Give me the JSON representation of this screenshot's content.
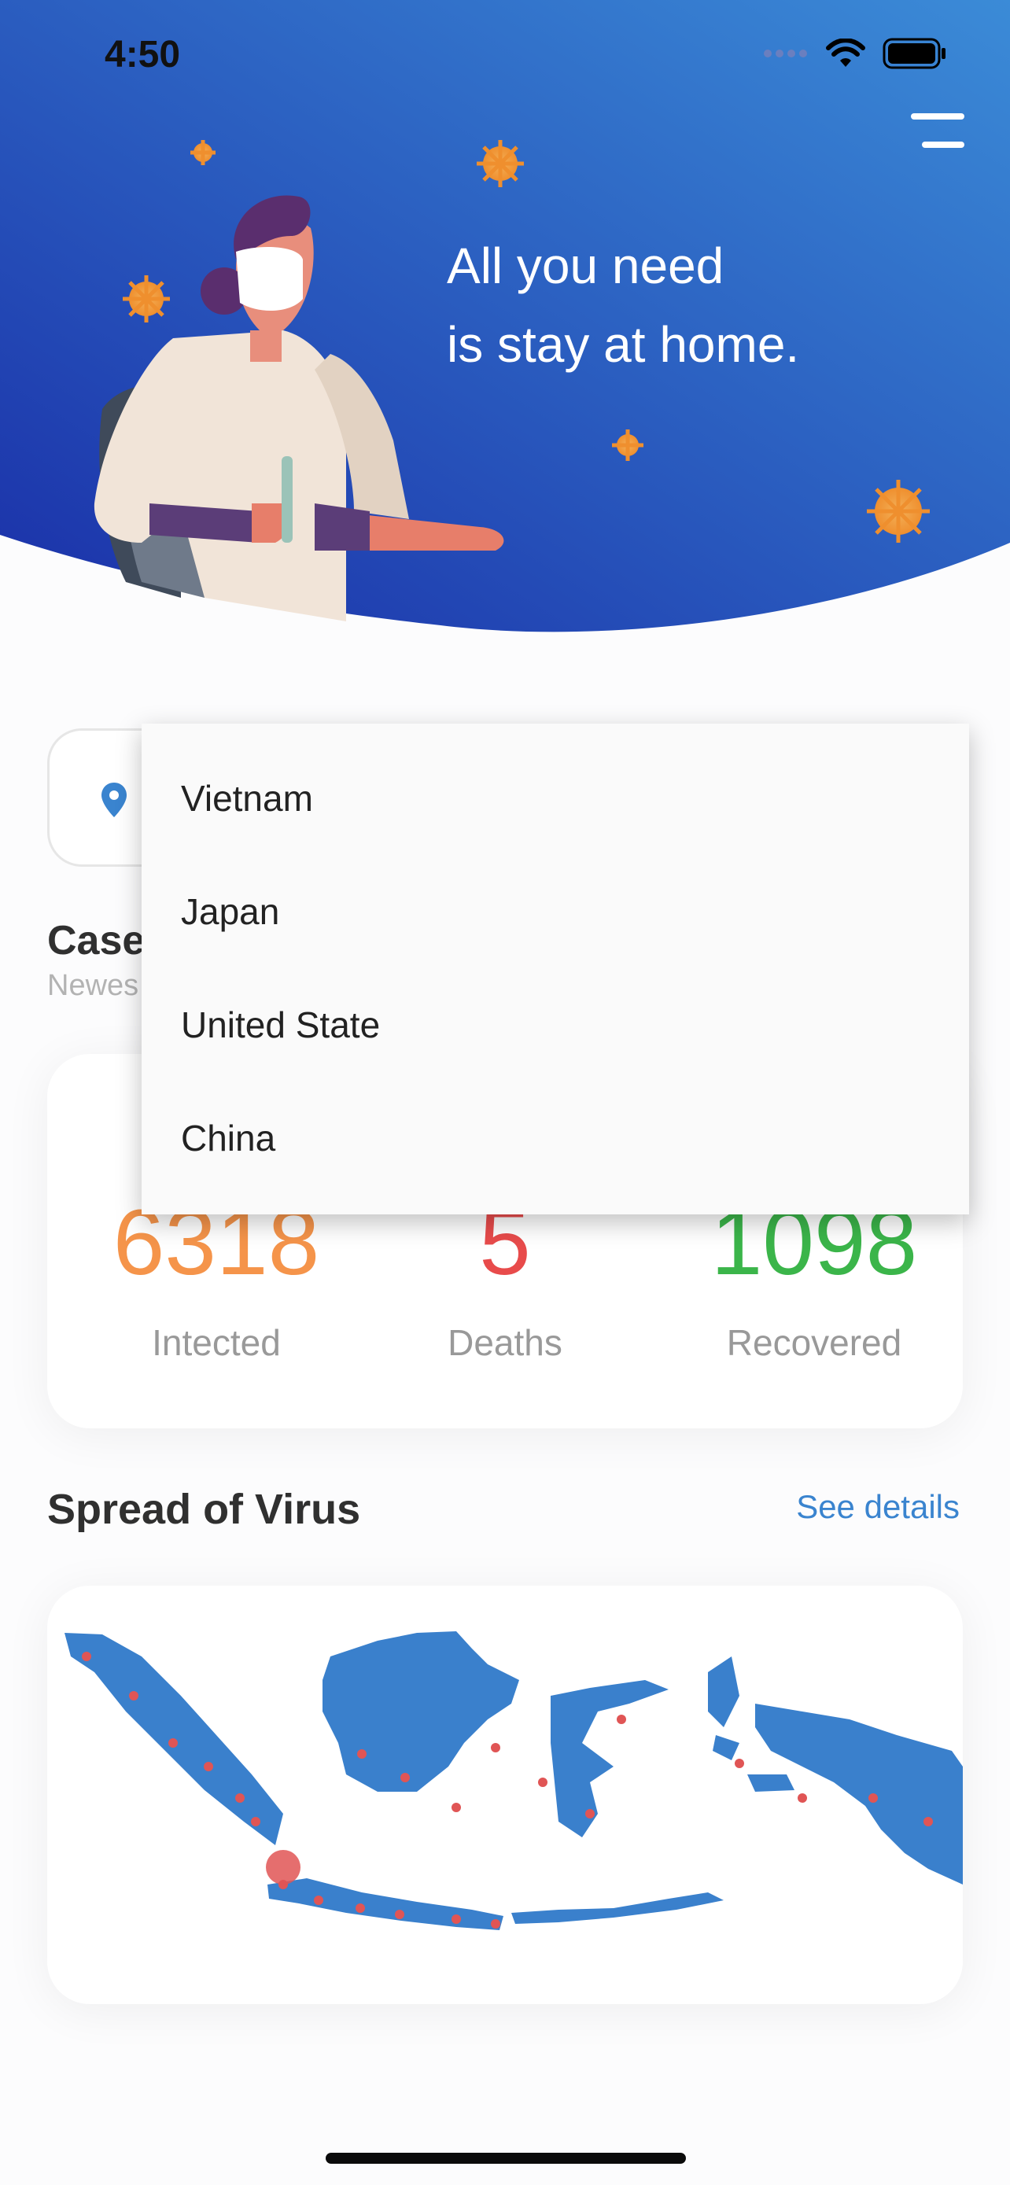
{
  "status_bar": {
    "time": "4:50"
  },
  "hero": {
    "line1": "All you need",
    "line2": "is stay at home."
  },
  "cases": {
    "title": "Case",
    "subtitle": "Newes"
  },
  "stats": [
    {
      "value": "6318",
      "label": "Intected",
      "color": "#f5944a"
    },
    {
      "value": "5",
      "label": "Deaths",
      "color": "#e84b4b"
    },
    {
      "value": "1098",
      "label": "Recovered",
      "color": "#3bb54a"
    }
  ],
  "spread": {
    "title": "Spread of Virus",
    "see_details": "See details"
  },
  "dropdown": {
    "options": [
      "Vietnam",
      "Japan",
      "United State",
      "China"
    ]
  },
  "icons": {
    "location": "location-pin-icon",
    "menu": "hamburger-menu-icon",
    "wifi": "wifi-icon",
    "battery": "battery-icon",
    "signal": "signal-icon"
  },
  "colors": {
    "hero_start": "#1a2fa8",
    "hero_end": "#3a8ad6",
    "accent": "#3a84cf",
    "map_blue": "#3a80cc",
    "map_dot": "#e05555"
  }
}
